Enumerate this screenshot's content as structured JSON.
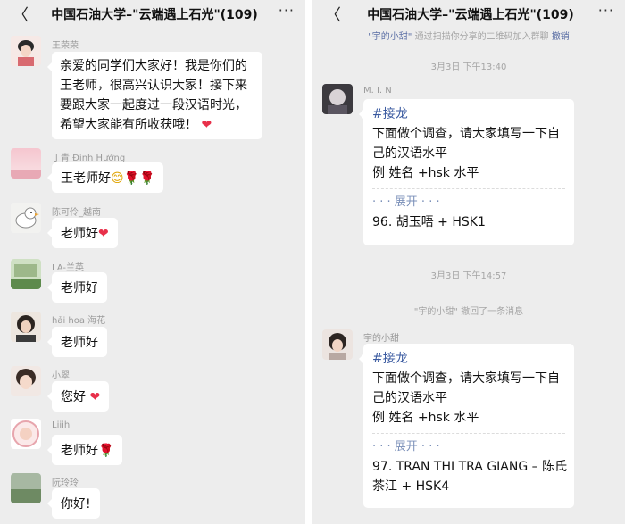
{
  "chat": {
    "title": "中国石油大学–\"云端遇上石光\"(109)",
    "back_icon": "chevron-left-icon",
    "more_icon": "more-dots-icon",
    "more_glyph": "···",
    "back_glyph": "〈"
  },
  "left": {
    "messages": [
      {
        "nick": "王荣荣",
        "text": "亲爱的同学们大家好！我是你们的王老师，很高兴认识大家！接下来要跟大家一起度过一段汉语时光，希望大家能有所收获哦！",
        "emoji": "❤"
      },
      {
        "nick": "丁青 Đinh Hường",
        "text": "王老师好",
        "emoji": "😊🌹🌹"
      },
      {
        "nick": "陈可伶_越南",
        "text": "老师好",
        "emoji": "❤"
      },
      {
        "nick": "LA-兰英",
        "text": "老师好",
        "emoji": ""
      },
      {
        "nick": "hải hoa 海花",
        "text": "老师好",
        "emoji": ""
      },
      {
        "nick": "小翠",
        "text": "您好",
        "emoji": "❤"
      },
      {
        "nick": "Liiih",
        "text": "老师好",
        "emoji": "🌹"
      },
      {
        "nick": "阮玲玲",
        "text": "你好!",
        "emoji": ""
      }
    ]
  },
  "right": {
    "system_notice": {
      "name": "\"宇的小甜\"",
      "text": "通过扫描你分享的二维码加入群聊",
      "action": "撤销"
    },
    "timestamp1": "3月3日 下午13:40",
    "timestamp2": "3月3日 下午14:57",
    "recall_notice": "\"宇的小甜\" 撤回了一条消息",
    "messages": [
      {
        "nick": "M. I. N",
        "tag": "#接龙",
        "line1": "下面做个调查，请大家填写一下自",
        "line2": "己的汉语水平",
        "line3": "例 姓名 +hsk 水平",
        "expand": "· · · 展开 · · ·",
        "entry": "96. 胡玉唔 + HSK1"
      },
      {
        "nick": "宇的小甜",
        "tag": "#接龙",
        "line1": "下面做个调查，请大家填写一下自",
        "line2": "己的汉语水平",
        "line3": "例 姓名 +hsk 水平",
        "expand": "· · · 展开 · · ·",
        "entry_line1": "97. TRAN THI TRA GIANG – 陈氏",
        "entry_line2": "茶江 + HSK4"
      }
    ]
  },
  "colors": {
    "panel_bg": "#ededed",
    "bubble_bg": "#ffffff",
    "heart": "#e8304a",
    "link": "#5b6fa5"
  }
}
